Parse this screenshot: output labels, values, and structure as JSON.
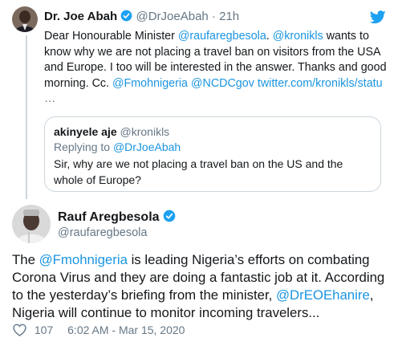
{
  "reply_tweet": {
    "author_name": "Dr. Joe Abah",
    "handle": "@DrJoeAbah",
    "separator": "·",
    "time": "21h",
    "text_segments": [
      {
        "text": "Dear Honourable Minister ",
        "link": false
      },
      {
        "text": "@raufaregbesola",
        "link": true
      },
      {
        "text": ". ",
        "link": false
      },
      {
        "text": "@kronikls",
        "link": true
      },
      {
        "text": " wants to know why we are not placing a travel ban on visitors from the USA and Europe. I too will be interested in the answer. Thanks and good morning. Cc. ",
        "link": false
      },
      {
        "text": "@Fmohnigeria",
        "link": true
      },
      {
        "text": " ",
        "link": false
      },
      {
        "text": "@NCDCgov",
        "link": true
      },
      {
        "text": " ",
        "link": false
      },
      {
        "text": "twitter.com/kronikls/statu",
        "link": true
      }
    ],
    "ellipsis": "…"
  },
  "quoted_tweet": {
    "author_name": "akinyele aje",
    "handle": "@kronikls",
    "replying_label": "Replying to ",
    "replying_handle": "@DrJoeAbah",
    "text": "Sir, why are we not placing a travel ban  on the US and the whole of Europe?"
  },
  "main_tweet": {
    "author_name": "Rauf Aregbesola",
    "handle": "@raufaregbesola",
    "text_segments": [
      {
        "text": "The ",
        "link": false
      },
      {
        "text": "@Fmohnigeria",
        "link": true
      },
      {
        "text": " is leading Nigeria’s efforts on combating Corona Virus and they are doing a fantastic job at it. According to the yesterday’s briefing from the minister, ",
        "link": false
      },
      {
        "text": "@DrEOEhanire",
        "link": true
      },
      {
        "text": ", Nigeria will continue to monitor incoming travelers...",
        "link": false
      }
    ],
    "likes": "107",
    "timestamp": "6:02 AM - Mar 15, 2020"
  },
  "icons": {
    "verified": "verified-badge-icon",
    "twitter": "twitter-bird-icon",
    "heart": "heart-icon"
  },
  "colors": {
    "link": "#1b95e0",
    "verified": "#1da1f2",
    "muted": "#657786",
    "text": "#14171a",
    "border": "#ccd6dd"
  }
}
